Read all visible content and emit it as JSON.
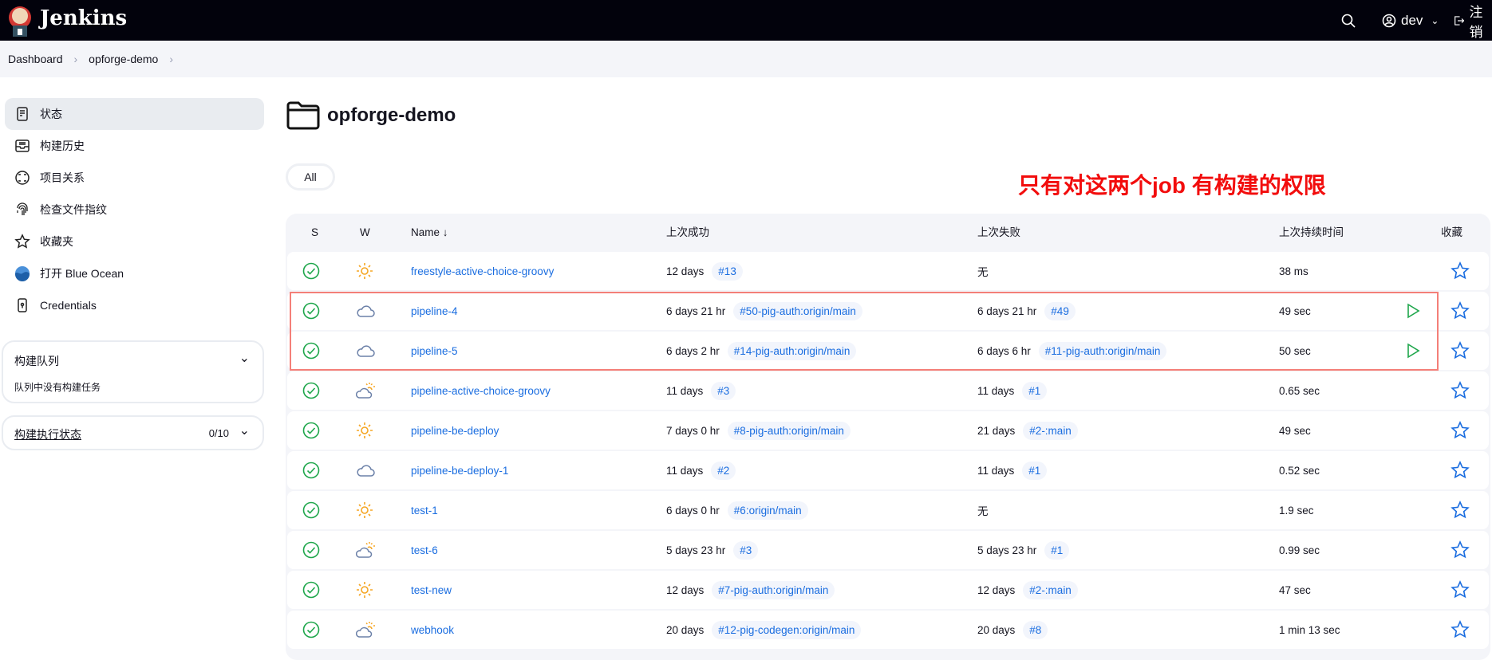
{
  "header": {
    "brand": "Jenkins",
    "user": "dev",
    "logout": "注销"
  },
  "breadcrumb": [
    "Dashboard",
    "opforge-demo"
  ],
  "sidebar": {
    "items": [
      {
        "label": "状态",
        "icon": "document-icon"
      },
      {
        "label": "构建历史",
        "icon": "inbox-icon"
      },
      {
        "label": "项目关系",
        "icon": "relations-icon"
      },
      {
        "label": "检查文件指纹",
        "icon": "fingerprint-icon"
      },
      {
        "label": "收藏夹",
        "icon": "star-icon"
      },
      {
        "label": "打开 Blue Ocean",
        "icon": "blue-ocean-icon"
      },
      {
        "label": "Credentials",
        "icon": "credentials-icon"
      }
    ],
    "queue": {
      "title": "构建队列",
      "empty": "队列中没有构建任务"
    },
    "executors": {
      "title": "构建执行状态",
      "count": "0/10"
    }
  },
  "main": {
    "title": "opforge-demo",
    "view_tab": "All",
    "annotation": "只有对这两个job 有构建的权限",
    "columns": {
      "s": "S",
      "w": "W",
      "name": "Name ↓",
      "last_success": "上次成功",
      "last_failure": "上次失败",
      "last_duration": "上次持续时间",
      "fav": "收藏"
    },
    "rows": [
      {
        "name": "freestyle-active-choice-groovy",
        "weather": "sun",
        "ls": "12 days",
        "lsb": "#13",
        "lf": "无",
        "lfb": "",
        "dur": "38 ms",
        "build": false
      },
      {
        "name": "pipeline-4",
        "weather": "cloud",
        "ls": "6 days 21 hr",
        "lsb": "#50-pig-auth:origin/main",
        "lf": "6 days 21 hr",
        "lfb": "#49",
        "dur": "49 sec",
        "build": true
      },
      {
        "name": "pipeline-5",
        "weather": "cloud",
        "ls": "6 days 2 hr",
        "lsb": "#14-pig-auth:origin/main",
        "lf": "6 days 6 hr",
        "lfb": "#11-pig-auth:origin/main",
        "dur": "50 sec",
        "build": true
      },
      {
        "name": "pipeline-active-choice-groovy",
        "weather": "partly",
        "ls": "11 days",
        "lsb": "#3",
        "lf": "11 days",
        "lfb": "#1",
        "dur": "0.65 sec",
        "build": false
      },
      {
        "name": "pipeline-be-deploy",
        "weather": "sun",
        "ls": "7 days 0 hr",
        "lsb": "#8-pig-auth:origin/main",
        "lf": "21 days",
        "lfb": "#2-:main",
        "dur": "49 sec",
        "build": false
      },
      {
        "name": "pipeline-be-deploy-1",
        "weather": "cloud",
        "ls": "11 days",
        "lsb": "#2",
        "lf": "11 days",
        "lfb": "#1",
        "dur": "0.52 sec",
        "build": false
      },
      {
        "name": "test-1",
        "weather": "sun",
        "ls": "6 days 0 hr",
        "lsb": "#6:origin/main",
        "lf": "无",
        "lfb": "",
        "dur": "1.9 sec",
        "build": false
      },
      {
        "name": "test-6",
        "weather": "partly",
        "ls": "5 days 23 hr",
        "lsb": "#3",
        "lf": "5 days 23 hr",
        "lfb": "#1",
        "dur": "0.99 sec",
        "build": false
      },
      {
        "name": "test-new",
        "weather": "sun",
        "ls": "12 days",
        "lsb": "#7-pig-auth:origin/main",
        "lf": "12 days",
        "lfb": "#2-:main",
        "dur": "47 sec",
        "build": false
      },
      {
        "name": "webhook",
        "weather": "partly",
        "ls": "20 days",
        "lsb": "#12-pig-codegen:origin/main",
        "lf": "20 days",
        "lfb": "#8",
        "dur": "1 min 13 sec",
        "build": false
      }
    ]
  },
  "colors": {
    "accent": "#1a6de0",
    "success": "#1ea64b",
    "annotation": "#f20d0d",
    "sun": "#f5a623",
    "cloud": "#6b80a8"
  }
}
